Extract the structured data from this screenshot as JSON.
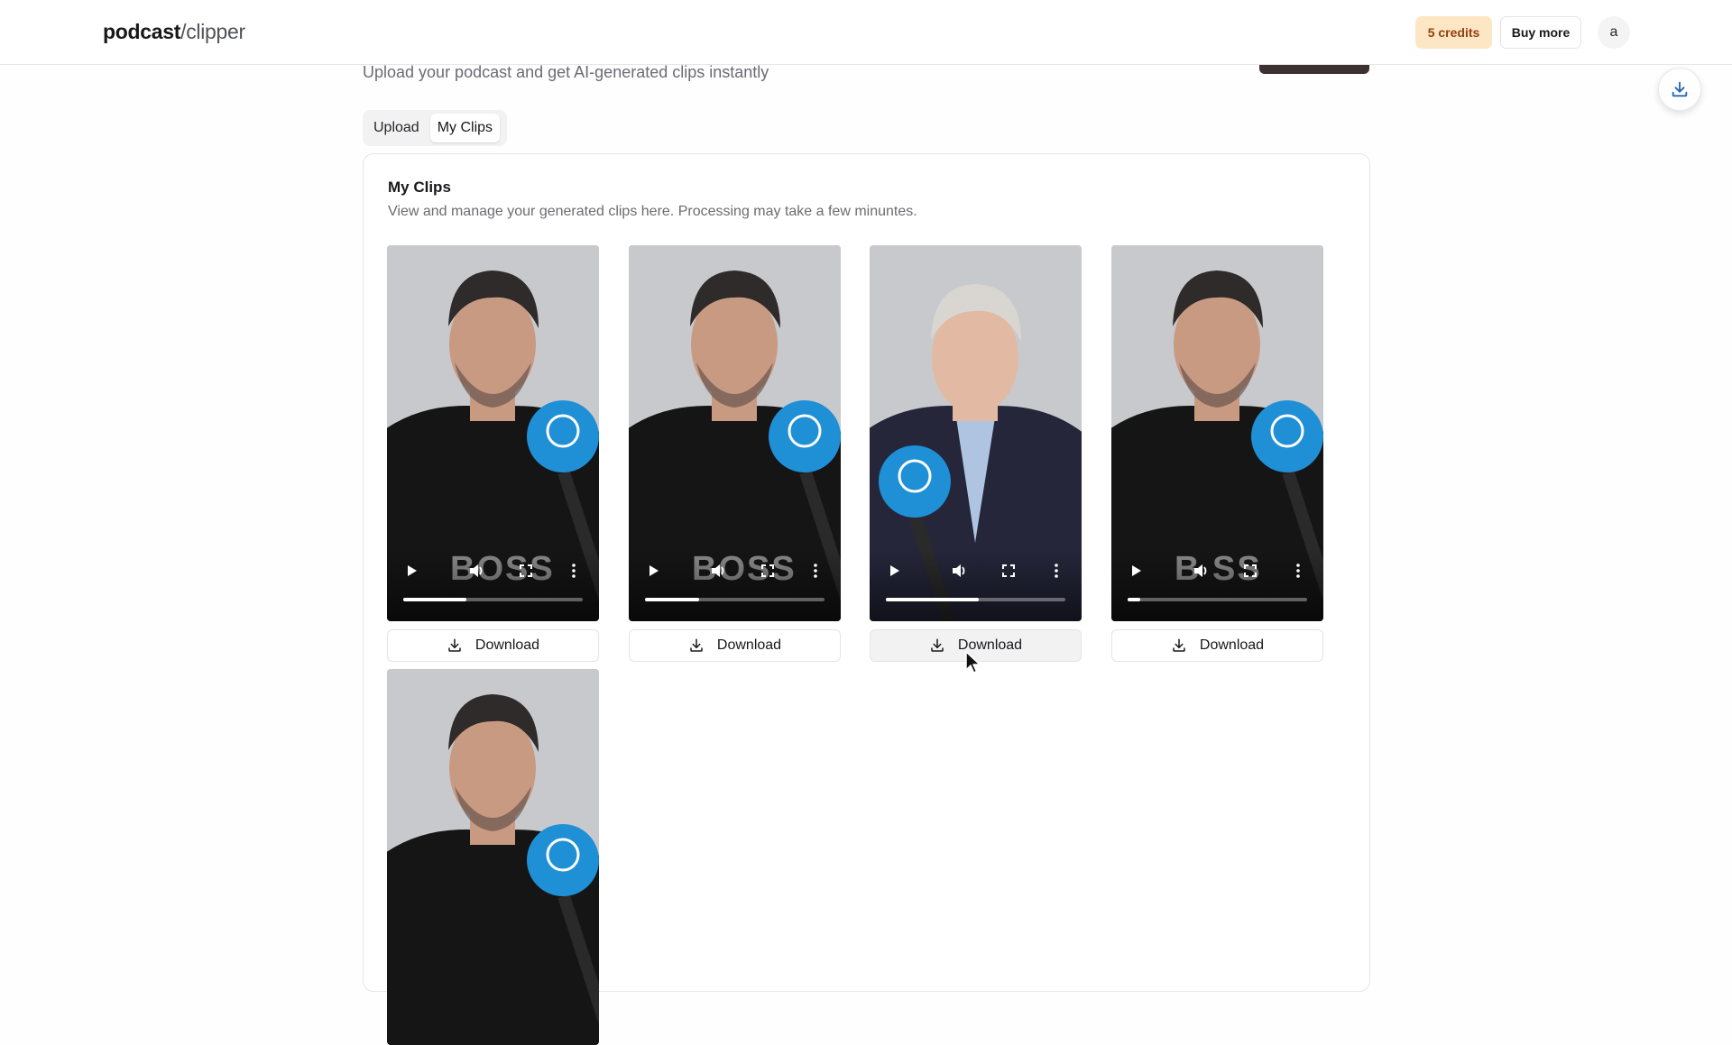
{
  "header": {
    "logo_bold": "podcast",
    "logo_slash": "/",
    "logo_light": "clipper",
    "credits_label": "5 credits",
    "buy_more_label": "Buy more",
    "avatar_initial": "a"
  },
  "page": {
    "subtitle": "Upload your podcast and get AI-generated clips instantly"
  },
  "tabs": [
    {
      "label": "Upload",
      "active": false
    },
    {
      "label": "My Clips",
      "active": true
    }
  ],
  "clips_card": {
    "title": "My Clips",
    "description": "View and manage your generated clips here. Processing may take a few minuntes."
  },
  "clips": [
    {
      "download_label": "Download",
      "subject": "younger-man-dark-tshirt-speaking",
      "progress": 0.35,
      "overlay_text": "BOSS"
    },
    {
      "download_label": "Download",
      "subject": "younger-man-dark-tshirt-speaking",
      "progress": 0.3,
      "overlay_text": "BOSS"
    },
    {
      "download_label": "Download",
      "subject": "older-man-white-hair-laughing",
      "progress": 0.52,
      "overlay_text": ""
    },
    {
      "download_label": "Download",
      "subject": "younger-man-dark-tshirt-laughing",
      "progress": 0.07,
      "overlay_text": "B SS"
    },
    {
      "download_label": "Download",
      "subject": "younger-man-dark-tshirt-eyes-down",
      "progress": 0.0,
      "overlay_text": ""
    }
  ],
  "colors": {
    "credits_bg": "#fde6c4",
    "mic_blue": "#1f8fd6",
    "accent_dark": "#3b3231"
  }
}
